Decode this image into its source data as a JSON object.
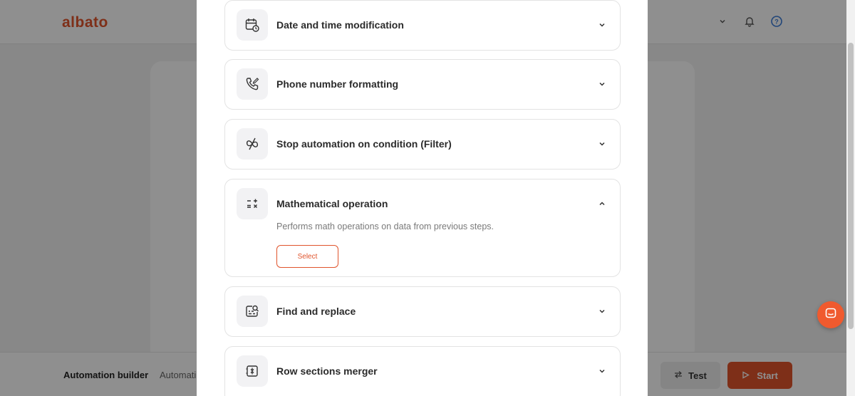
{
  "app": {
    "logo": "albato",
    "bottombar": {
      "title": "Automation builder",
      "crumb": "Automati",
      "test_label": "Test",
      "start_label": "Start"
    }
  },
  "modal": {
    "items": [
      {
        "title": "Date and time modification",
        "icon": "calendar-clock-icon",
        "expanded": false
      },
      {
        "title": "Phone number formatting",
        "icon": "phone-edit-icon",
        "expanded": false
      },
      {
        "title": "Stop automation on condition (Filter)",
        "icon": "filter-stop-icon",
        "expanded": false
      },
      {
        "title": "Mathematical operation",
        "icon": "math-operations-icon",
        "expanded": true,
        "description": "Performs math operations on data from previous steps.",
        "select_label": "Select"
      },
      {
        "title": "Find and replace",
        "icon": "find-replace-icon",
        "expanded": false
      },
      {
        "title": "Row sections merger",
        "icon": "merge-rows-icon",
        "expanded": false
      }
    ]
  },
  "colors": {
    "accent": "#e0542c",
    "help": "#3b7bd8"
  }
}
